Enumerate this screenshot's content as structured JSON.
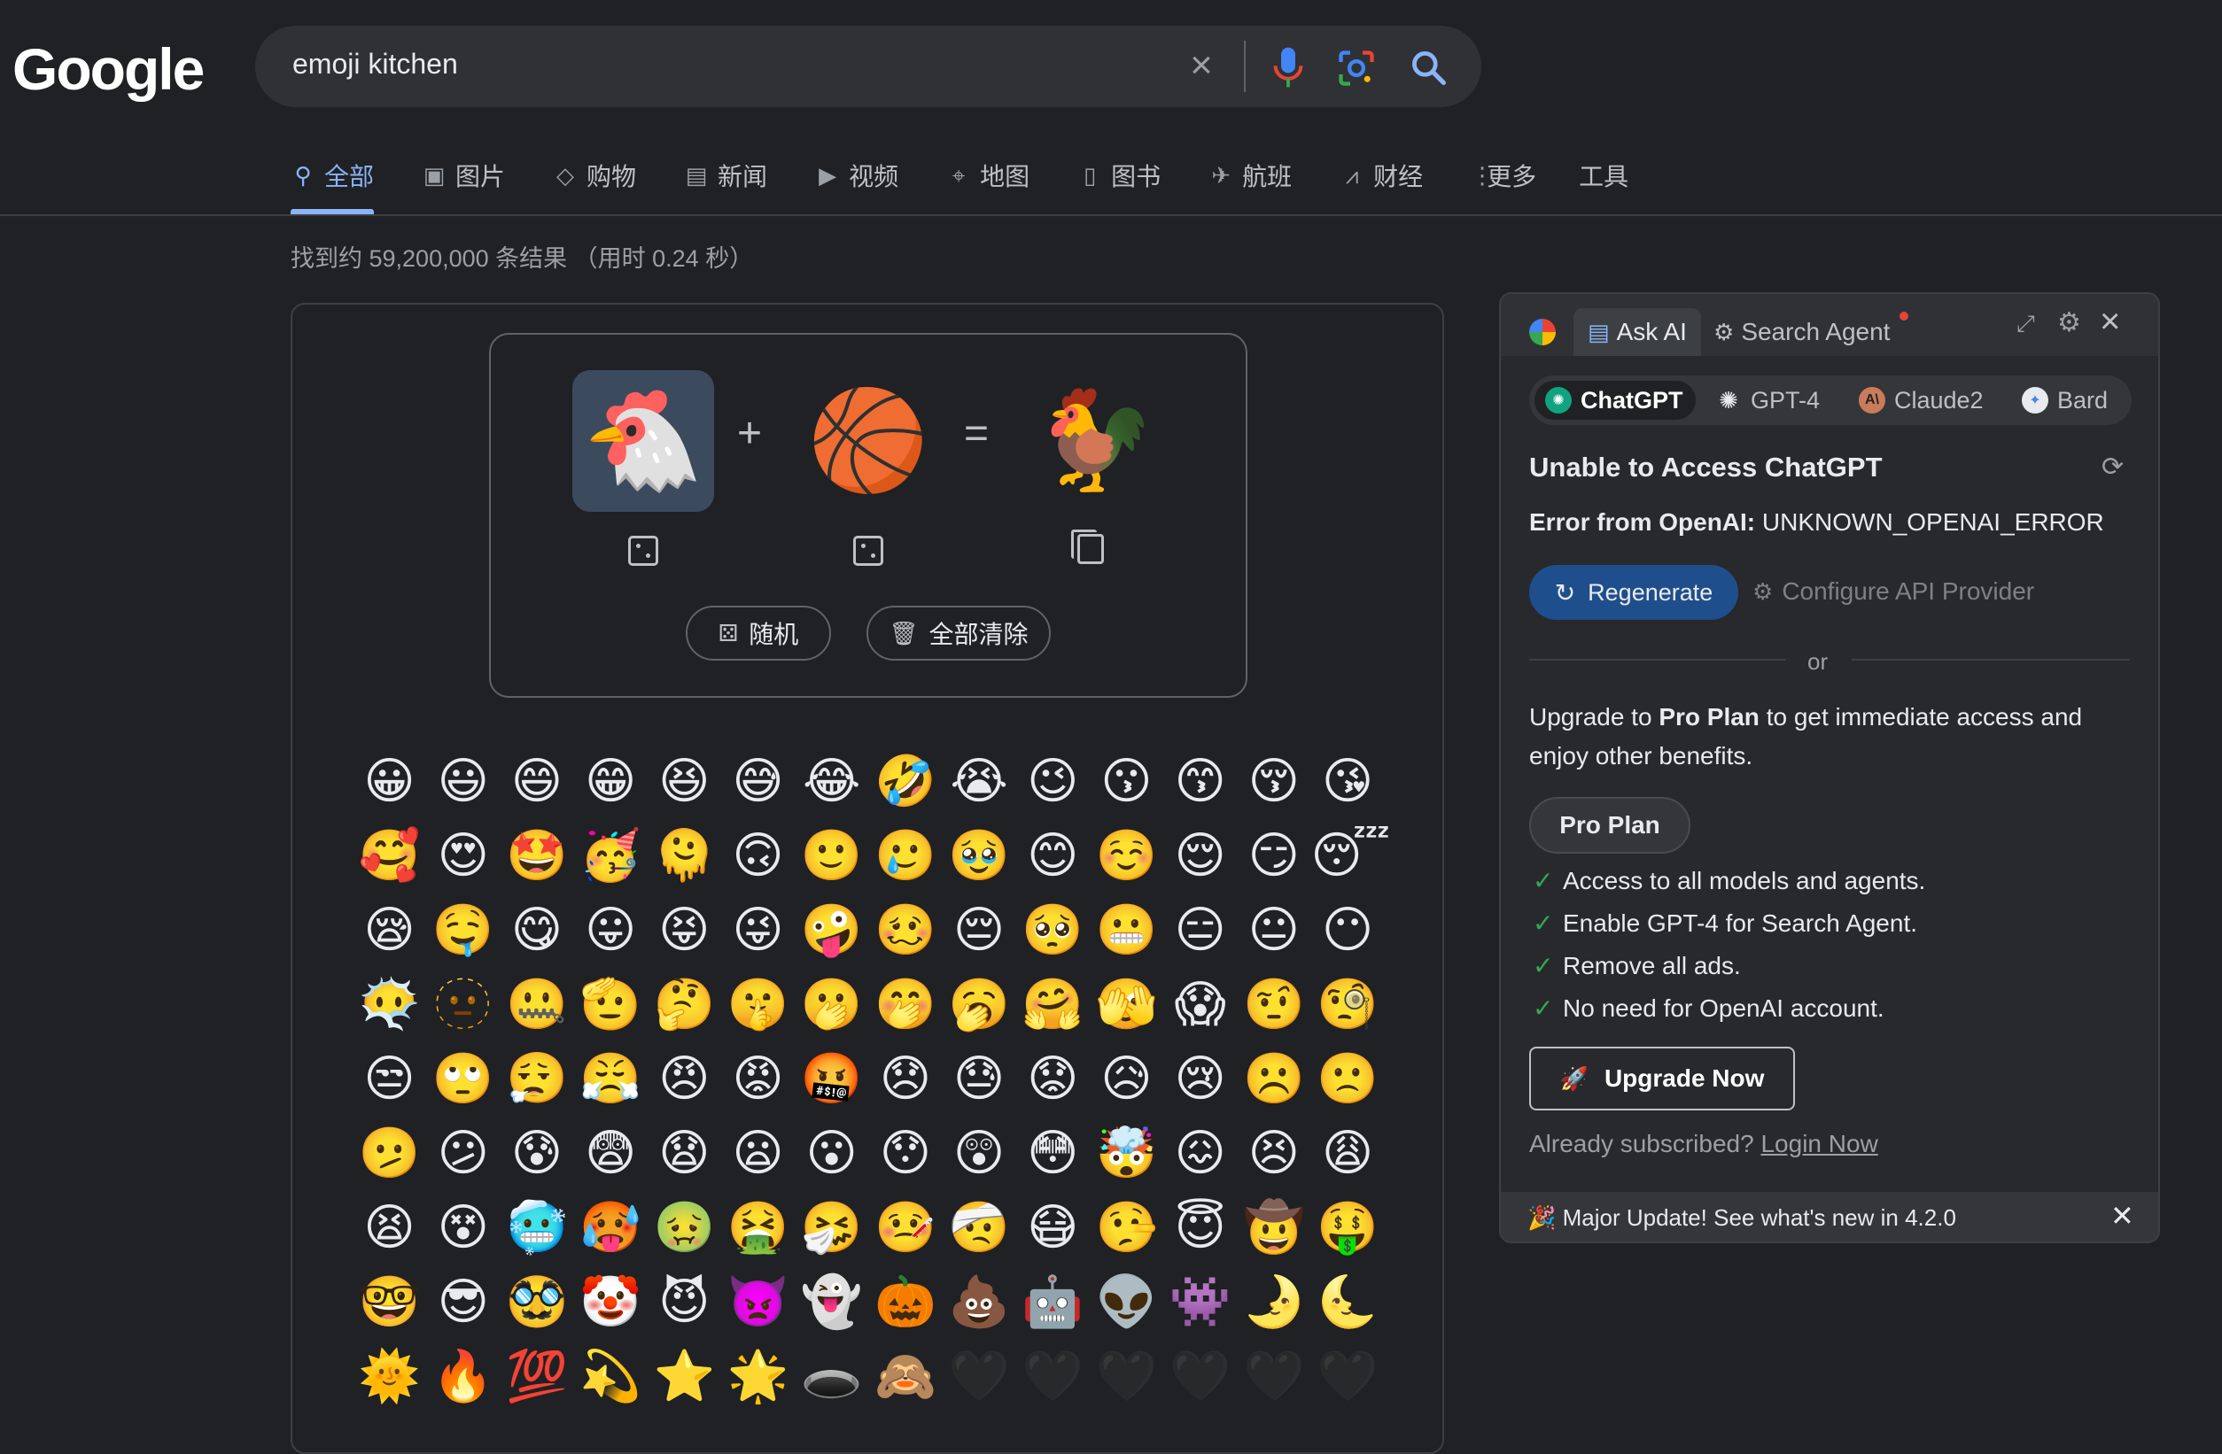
{
  "logo": "Google",
  "search": {
    "query": "emoji kitchen"
  },
  "tabs": [
    {
      "label": "全部",
      "icon": "search-icon"
    },
    {
      "label": "图片",
      "icon": "image-icon"
    },
    {
      "label": "购物",
      "icon": "tag-icon"
    },
    {
      "label": "新闻",
      "icon": "news-icon"
    },
    {
      "label": "视频",
      "icon": "play-icon"
    },
    {
      "label": "地图",
      "icon": "map-pin-icon"
    },
    {
      "label": "图书",
      "icon": "book-icon"
    },
    {
      "label": "航班",
      "icon": "plane-icon"
    },
    {
      "label": "财经",
      "icon": "chart-icon"
    },
    {
      "label": "更多",
      "icon": "more-vert-icon"
    },
    {
      "label": "工具",
      "icon": ""
    }
  ],
  "result_stats": "找到约 59,200,000 条结果 （用时 0.24 秒）",
  "kitchen": {
    "slot1": "🐔",
    "slot2": "🏀",
    "result": "🐓",
    "plus": "+",
    "equals": "=",
    "random_label": "随机",
    "clear_all_label": "全部清除"
  },
  "emoji_grid": [
    "😀",
    "😃",
    "😄",
    "😁",
    "😆",
    "😅",
    "😂",
    "🤣",
    "😭",
    "😉",
    "😗",
    "😙",
    "😚",
    "😘",
    "🥰",
    "😍",
    "🤩",
    "🥳",
    "🫠",
    "🙃",
    "🙂",
    "🥲",
    "🥹",
    "😊",
    "☺️",
    "😌",
    "😏",
    "😴",
    "😪",
    "🤤",
    "😋",
    "😛",
    "😝",
    "😜",
    "🤪",
    "🥴",
    "😔",
    "🥺",
    "😬",
    "😑",
    "😐",
    "😶",
    "😶‍🌫️",
    "🫥",
    "🤐",
    "🫡",
    "🤔",
    "🤫",
    "🫢",
    "🤭",
    "🥱",
    "🤗",
    "🫣",
    "😱",
    "🤨",
    "🧐",
    "😒",
    "🙄",
    "😮‍💨",
    "😤",
    "😠",
    "😡",
    "🤬",
    "😞",
    "😓",
    "😟",
    "😥",
    "😢",
    "☹️",
    "🙁",
    "🫤",
    "😕",
    "😰",
    "😨",
    "😧",
    "😦",
    "😮",
    "😯",
    "😲",
    "😳",
    "🤯",
    "😖",
    "😣",
    "😩",
    "😫",
    "😵",
    "🥶",
    "🥵",
    "🤢",
    "🤮",
    "🤧",
    "🤒",
    "🤕",
    "😷",
    "🤥",
    "😇",
    "🤠",
    "🤑",
    "🤓",
    "😎",
    "🥸",
    "🤡",
    "😈",
    "👿",
    "👻",
    "🎃",
    "💩",
    "🤖",
    "👽",
    "👾",
    "🌛",
    "🌜",
    "🌞",
    "🔥",
    "💯",
    "💫",
    "⭐",
    "🌟",
    "🕳️",
    "🙈",
    "🖤",
    "🖤",
    "🖤",
    "🖤",
    "🖤",
    "🖤"
  ],
  "panel": {
    "tab_ask": "Ask AI",
    "tab_agent": "Search Agent",
    "models": [
      {
        "label": "ChatGPT",
        "color": "#10a37f"
      },
      {
        "label": "GPT-4",
        "color": "#202124"
      },
      {
        "label": "Claude2",
        "color": "#c97b5a"
      },
      {
        "label": "Bard",
        "color": "#4285f4"
      }
    ],
    "error_title": "Unable to Access ChatGPT",
    "error_label": "Error from OpenAI:",
    "error_code": "UNKNOWN_OPENAI_ERROR",
    "regenerate": "Regenerate",
    "configure": "Configure API Provider",
    "or": "or",
    "upgrade_pre": "Upgrade to ",
    "upgrade_plan": "Pro Plan",
    "upgrade_post": " to get immediate access and enjoy other benefits.",
    "pro_plan_btn": "Pro Plan",
    "benefits": [
      "Access to all models and agents.",
      "Enable GPT-4 for Search Agent.",
      "Remove all ads.",
      "No need for OpenAI account."
    ],
    "upgrade_now": "Upgrade Now",
    "already_subscribed": "Already subscribed?",
    "login_now": "Login Now",
    "update_banner": "🎉 Major Update! See what's new in 4.2.0"
  },
  "colors": {
    "accent": "#8ab4f8",
    "background": "#202124",
    "regen": "#1f4e8c",
    "check": "#34a853"
  }
}
